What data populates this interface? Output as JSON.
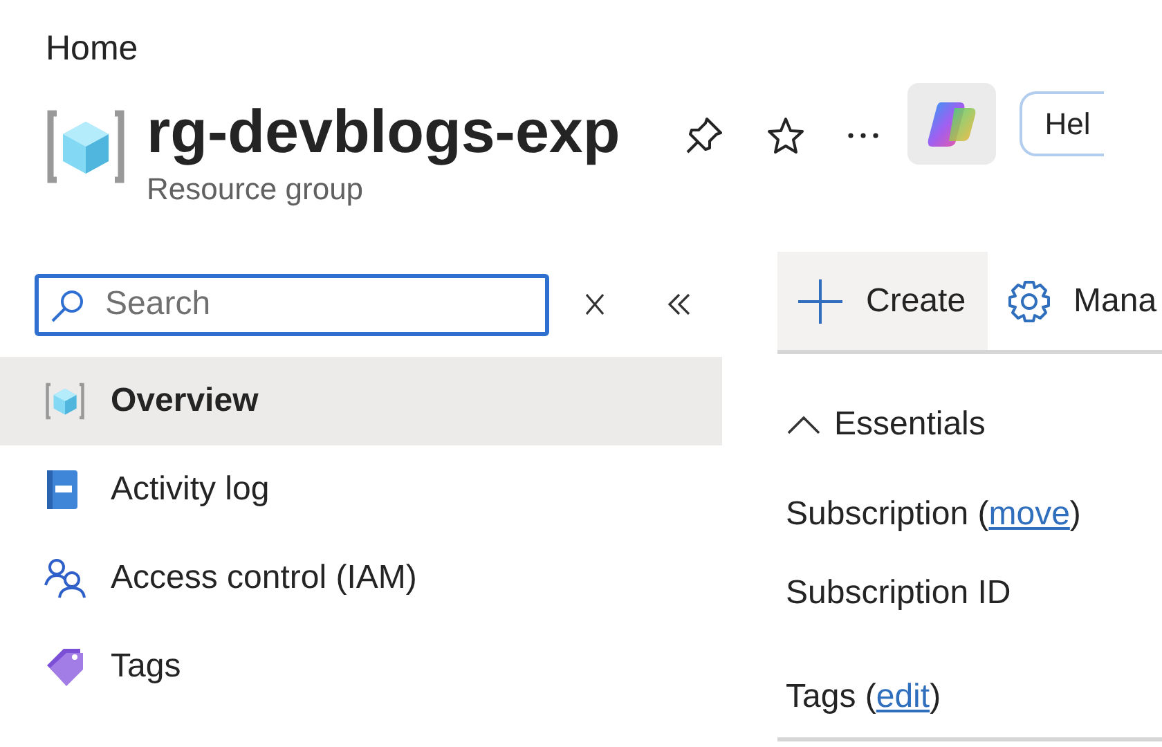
{
  "breadcrumb": "Home",
  "header": {
    "title": "rg-devblogs-exp",
    "subtitle": "Resource group",
    "help_button": "Hel"
  },
  "sidebar": {
    "search": {
      "placeholder": "Search"
    },
    "items": [
      {
        "label": "Overview",
        "selected": true
      },
      {
        "label": "Activity log",
        "selected": false
      },
      {
        "label": "Access control (IAM)",
        "selected": false
      },
      {
        "label": "Tags",
        "selected": false
      }
    ]
  },
  "toolbar": [
    {
      "label": "Create",
      "highlighted": true
    },
    {
      "label": "Mana",
      "highlighted": false
    }
  ],
  "essentials": {
    "heading": "Essentials",
    "expanded": true,
    "fields": [
      {
        "before": "Subscription (",
        "link": "move",
        "after": ")"
      },
      {
        "before": "Subscription ID"
      },
      {
        "before": "Tags (",
        "link": "edit",
        "after": ")"
      }
    ]
  }
}
